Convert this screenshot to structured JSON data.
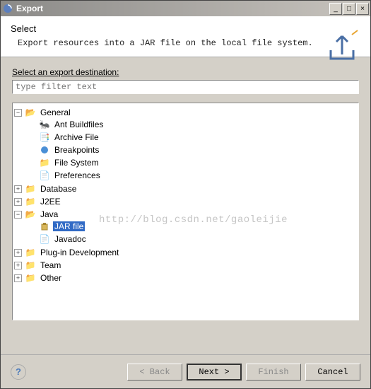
{
  "window": {
    "title": "Export"
  },
  "header": {
    "title": "Select",
    "description": "Export resources into a JAR file on the local file system."
  },
  "dest_label": "Select an export destination:",
  "filter_placeholder": "type filter text",
  "tree": {
    "general": {
      "label": "General",
      "ant": "Ant Buildfiles",
      "archive": "Archive File",
      "breakpoints": "Breakpoints",
      "filesystem": "File System",
      "preferences": "Preferences"
    },
    "database": "Database",
    "j2ee": "J2EE",
    "java": {
      "label": "Java",
      "jar": "JAR file",
      "javadoc": "Javadoc"
    },
    "plugin": "Plug-in Development",
    "team": "Team",
    "other": "Other"
  },
  "watermark": "http://blog.csdn.net/gaoleijie",
  "buttons": {
    "back": "< Back",
    "next": "Next >",
    "finish": "Finish",
    "cancel": "Cancel"
  }
}
